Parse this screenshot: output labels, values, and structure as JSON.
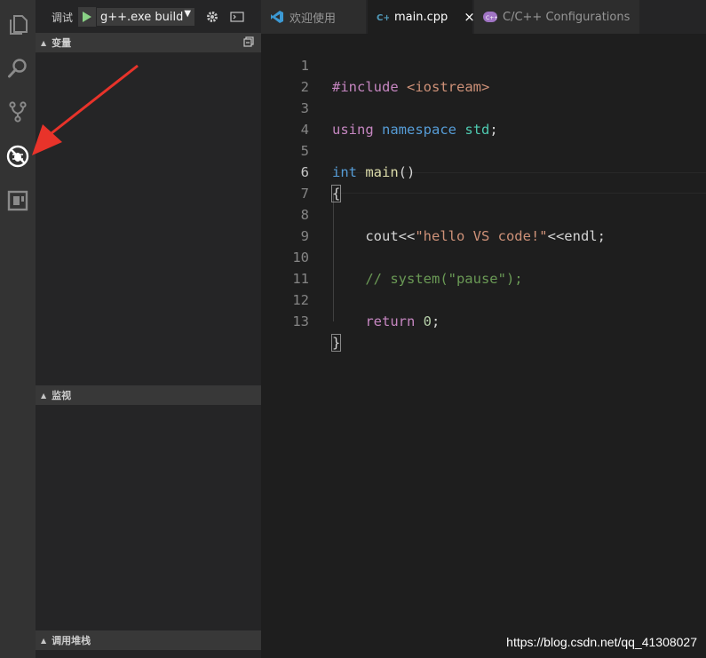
{
  "activity_bar": {
    "icons": [
      "explorer-icon",
      "search-icon",
      "source-control-icon",
      "debug-icon",
      "extensions-icon"
    ]
  },
  "debug_toolbar": {
    "title": "调试",
    "configuration": "g++.exe build",
    "start_icon": "play-icon",
    "settings_icon": "gear-icon",
    "console_icon": "terminal-icon"
  },
  "sections": {
    "variables": "变量",
    "watch": "监视",
    "call_stack": "调用堆栈"
  },
  "tabs": [
    {
      "label": "欢迎使用",
      "icon": "vscode-icon",
      "active": false
    },
    {
      "label": "main.cpp",
      "icon": "cpp-icon",
      "active": true,
      "close": "×"
    },
    {
      "label": "C/C++ Configurations",
      "icon": "cpp-config-icon",
      "active": false
    }
  ],
  "editor": {
    "line_numbers": [
      "1",
      "2",
      "3",
      "4",
      "5",
      "6",
      "7",
      "8",
      "9",
      "10",
      "11",
      "12",
      "13"
    ],
    "active_line": "6",
    "code": {
      "l1_directive": "#include",
      "l1_header": "<iostream>",
      "l3_using": "using",
      "l3_namespace": "namespace",
      "l3_std": "std",
      "l3_semi": ";",
      "l5_int": "int",
      "l5_main": "main",
      "l5_parens": "()",
      "l6_brace": "{",
      "l8_cout": "cout<<",
      "l8_string": "\"hello VS code!\"",
      "l8_endl": "<<endl;",
      "l10_comment": "// system(\"pause\");",
      "l12_return": "return",
      "l12_zero": "0",
      "l12_semi": ";",
      "l13_brace": "}"
    }
  },
  "watermark": "https://blog.csdn.net/qq_41308027",
  "colors": {
    "activity_bar": "#333333",
    "sidebar": "#252526",
    "editor": "#1e1e1e",
    "annotation_arrow": "#e8332a"
  }
}
